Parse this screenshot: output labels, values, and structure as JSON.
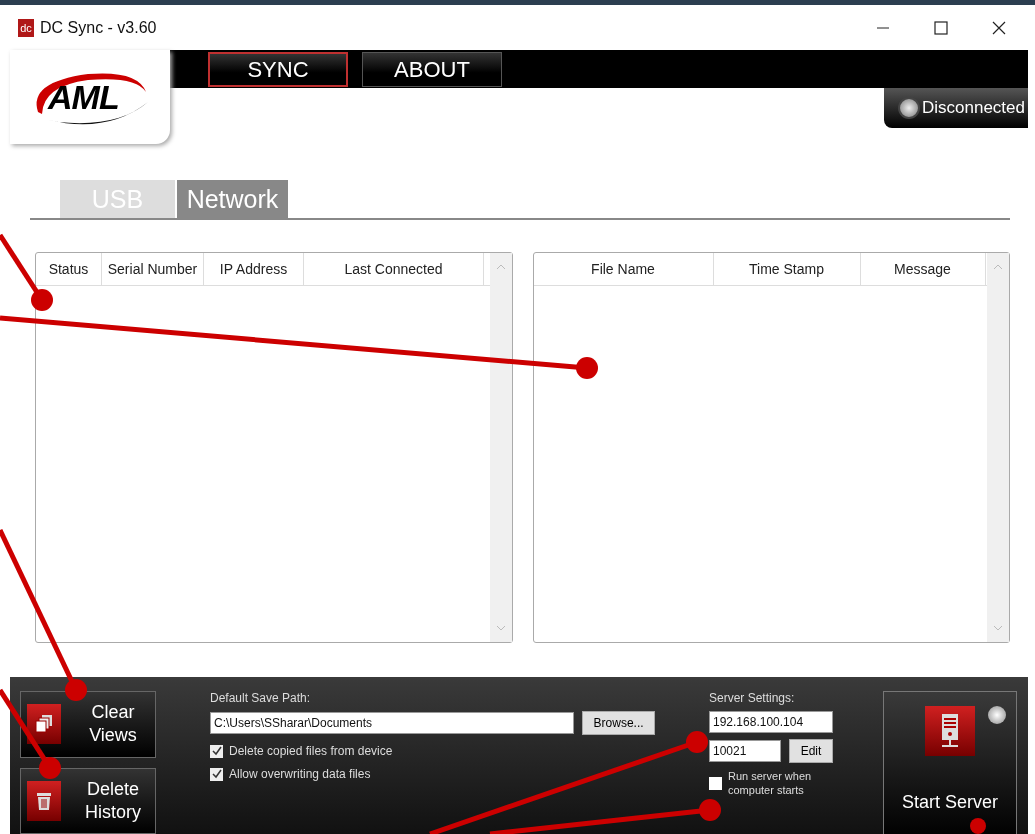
{
  "window": {
    "title": "DC Sync - v3.60",
    "app_icon_text": "dc"
  },
  "nav_tabs": [
    {
      "label": "SYNC",
      "selected": true
    },
    {
      "label": "ABOUT",
      "selected": false
    }
  ],
  "logo": {
    "text": "AML"
  },
  "connection": {
    "label": "Disconnected",
    "connected": false
  },
  "tabs": [
    {
      "label": "USB",
      "selected": false
    },
    {
      "label": "Network",
      "selected": true
    }
  ],
  "devices_table": {
    "columns": [
      "Status",
      "Serial Number",
      "IP Address",
      "Last Connected"
    ]
  },
  "files_table": {
    "columns": [
      "File Name",
      "Time Stamp",
      "Message"
    ]
  },
  "bottom": {
    "clear_views": "Clear Views",
    "delete_history": "Delete History",
    "save_path": {
      "label": "Default Save Path:",
      "value": "C:\\Users\\SSharar\\Documents",
      "browse": "Browse..."
    },
    "options": [
      {
        "label": "Delete copied files from device",
        "checked": true
      },
      {
        "label": "Allow overwriting data files",
        "checked": true
      }
    ],
    "server": {
      "label": "Server Settings:",
      "ip": "192.168.100.104",
      "port": "10021",
      "edit": "Edit",
      "autorun": {
        "label": "Run server when computer starts",
        "checked": false
      }
    },
    "start_server": {
      "label": "Start Server",
      "running": false
    }
  }
}
